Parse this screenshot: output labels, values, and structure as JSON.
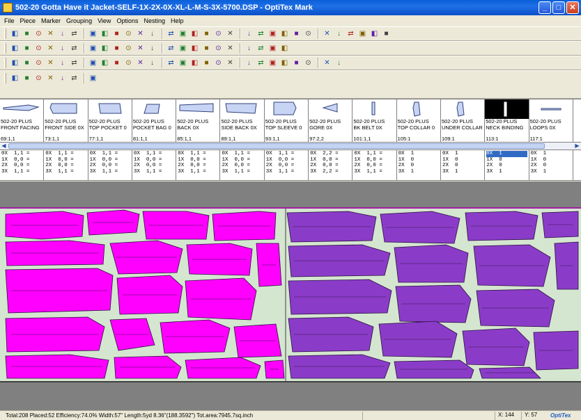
{
  "window": {
    "title": "502-20 Gotta Have it Jacket-SELF-1X-2X-0X-XL-L-M-S-3X-5700.DSP - OptiTex Mark",
    "minimize": "_",
    "maximize": "□",
    "close": "✕"
  },
  "menu": [
    "File",
    "Piece",
    "Marker",
    "Grouping",
    "View",
    "Options",
    "Nesting",
    "Help"
  ],
  "pieces": [
    {
      "line1": "502-20 PLUS",
      "line2": "FRONT FACING",
      "count": "69:1,1",
      "shape": "front-facing"
    },
    {
      "line1": "502-20 PLUS",
      "line2": "FRONT SIDE 0X",
      "count": "73:1,1",
      "shape": "front-side"
    },
    {
      "line1": "502-20 PLUS",
      "line2": "TOP POCKET 0",
      "count": "77:1,1",
      "shape": "top-pocket"
    },
    {
      "line1": "502-20 PLUS",
      "line2": "POCKET BAG 0",
      "count": "81:1,1",
      "shape": "pocket-bag"
    },
    {
      "line1": "502-20 PLUS",
      "line2": "BACK 0X",
      "count": "85:1,1",
      "shape": "back"
    },
    {
      "line1": "502-20 PLUS",
      "line2": "SIDE BACK 0X",
      "count": "89:1,1",
      "shape": "side-back"
    },
    {
      "line1": "502-20 PLUS",
      "line2": "TOP SLEEVE 0",
      "count": "93:1,1",
      "shape": "top-sleeve"
    },
    {
      "line1": "502-20 PLUS",
      "line2": "GORE 0X",
      "count": "97:2,2",
      "shape": "gore"
    },
    {
      "line1": "502-20 PLUS",
      "line2": "BK BELT 0X",
      "count": "101:1,1",
      "shape": "bk-belt"
    },
    {
      "line1": "502-20 PLUS",
      "line2": "TOP COLLAR 0",
      "count": "105:1",
      "shape": "top-collar"
    },
    {
      "line1": "502-20 PLUS",
      "line2": "UNDER COLLAR",
      "count": "109:1",
      "shape": "under-collar"
    },
    {
      "line1": "502-20 PLUS",
      "line2": "NECK BINDING",
      "count": "113:1",
      "shape": "neck-binding",
      "selected": true
    },
    {
      "line1": "502-20 PLUS",
      "line2": "LOOPS 0X",
      "count": "117:1",
      "shape": "loops"
    }
  ],
  "sizes": [
    [
      "0X  1,1 =",
      "1X  0,0 =",
      "2X  0,0 =",
      "3X  1,1 ="
    ],
    [
      "0X  1,1 =",
      "1X  0,0 =",
      "2X  0,0 =",
      "3X  1,1 ="
    ],
    [
      "0X  1,1 =",
      "1X  0,0 =",
      "2X  0,0 =",
      "3X  1,1 ="
    ],
    [
      "0X  1,1 =",
      "1X  0,0 =",
      "2X  0,0 =",
      "3X  1,1 ="
    ],
    [
      "0X  1,1 =",
      "1X  0,0 =",
      "2X  0,0 =",
      "3X  1,1 ="
    ],
    [
      "0X  1,1 =",
      "1X  0,0 =",
      "2X  0,0 =",
      "3X  1,1 ="
    ],
    [
      "0X  1,1 =",
      "1X  0,0 =",
      "2X  0,0 =",
      "3X  1,1 ="
    ],
    [
      "0X  2,2 =",
      "1X  0,0 =",
      "2X  0,0 =",
      "3X  2,2 ="
    ],
    [
      "0X  1,1 =",
      "1X  0,0 =",
      "2X  0,0 =",
      "3X  1,1 ="
    ],
    [
      "0X  1",
      "1X  0",
      "2X  0",
      "3X  1"
    ],
    [
      "0X  1",
      "1X  0",
      "2X  0",
      "3X  1"
    ],
    [
      "0X  1",
      "1X  0",
      "2X  0",
      "3X  1"
    ],
    [
      "0X  1",
      "1X  0",
      "2X  0",
      "3X  1"
    ]
  ],
  "selected_size_row": {
    "piece": 11,
    "row": 0
  },
  "colors": {
    "magenta": "#ff00ff",
    "purple": "#8a3cc8",
    "marker_bg": "#d5e6d0"
  },
  "status": {
    "main": "Total:208  Placed:52  Efficiency:74.0%  Width:57\"  Length:5yd 8.36\"(188.3592\")  Tot.area:7945.7sq.inch",
    "x": "X: 144",
    "y": "Y: 57",
    "brand": "OptiTex"
  },
  "toolbar_icons": {
    "row1": [
      "pointer-icon",
      "new-icon",
      "open-icon",
      "save-icon",
      "print-icon",
      "binoculars-icon",
      "link-icon",
      "tools-icon",
      "layout-icon",
      "print2-icon",
      "export-icon",
      "help-icon",
      "whatsthis-icon",
      "settings-icon",
      "ruler-icon",
      "grid-icon",
      "sheet-icon",
      "doc-icon",
      "doc2-icon",
      "doc3-icon",
      "doc4-icon",
      "zoom-in-icon",
      "zoom-out-icon",
      "zoom-fit-icon",
      "zoom-all-icon",
      "table-icon",
      "align-icon",
      "arrange-icon",
      "view-icon",
      "view2-icon"
    ],
    "row2": [
      "group-icon",
      "tree-icon",
      "delete-icon",
      "mark-icon",
      "pack-icon",
      "flag-icon",
      "spread-icon",
      "spread2-icon",
      "spread3-icon",
      "spread4-icon",
      "arrow-left-icon",
      "arrow-right-icon",
      "arrow-down-icon",
      "arrow-up-icon",
      "triangle-icon",
      "fold-icon",
      "cut-icon",
      "rotate-icon",
      "color-icon",
      "flip-icon",
      "pen-icon",
      "pencil-icon"
    ],
    "row3": [
      "nest-icon",
      "nest2-icon",
      "nest3-icon",
      "mirror-icon",
      "flip-h-icon",
      "flip-v-icon",
      "rotate-l-icon",
      "rotate-r-icon",
      "angle-icon",
      "angle2-icon",
      "frame-icon",
      "chart-icon",
      "paint-icon",
      "bar1-icon",
      "bar2-icon",
      "bar3-icon",
      "fill-icon",
      "fill2-icon",
      "fill3-icon",
      "tool-icon",
      "tool2-icon",
      "line-icon",
      "line2-icon",
      "line3-icon",
      "undo-icon",
      "redo-icon"
    ],
    "row4": [
      "box-icon",
      "box2-icon",
      "box3-icon",
      "box4-icon",
      "box5-icon",
      "box6-icon",
      "box7-icon"
    ]
  }
}
